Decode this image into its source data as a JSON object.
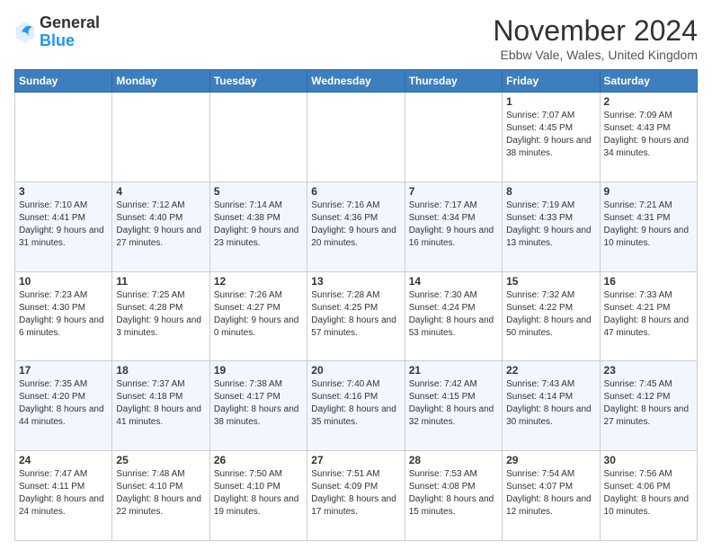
{
  "logo": {
    "general": "General",
    "blue": "Blue"
  },
  "header": {
    "month": "November 2024",
    "location": "Ebbw Vale, Wales, United Kingdom"
  },
  "days_of_week": [
    "Sunday",
    "Monday",
    "Tuesday",
    "Wednesday",
    "Thursday",
    "Friday",
    "Saturday"
  ],
  "weeks": [
    [
      {
        "day": "",
        "info": ""
      },
      {
        "day": "",
        "info": ""
      },
      {
        "day": "",
        "info": ""
      },
      {
        "day": "",
        "info": ""
      },
      {
        "day": "",
        "info": ""
      },
      {
        "day": "1",
        "info": "Sunrise: 7:07 AM\nSunset: 4:45 PM\nDaylight: 9 hours\nand 38 minutes."
      },
      {
        "day": "2",
        "info": "Sunrise: 7:09 AM\nSunset: 4:43 PM\nDaylight: 9 hours\nand 34 minutes."
      }
    ],
    [
      {
        "day": "3",
        "info": "Sunrise: 7:10 AM\nSunset: 4:41 PM\nDaylight: 9 hours\nand 31 minutes."
      },
      {
        "day": "4",
        "info": "Sunrise: 7:12 AM\nSunset: 4:40 PM\nDaylight: 9 hours\nand 27 minutes."
      },
      {
        "day": "5",
        "info": "Sunrise: 7:14 AM\nSunset: 4:38 PM\nDaylight: 9 hours\nand 23 minutes."
      },
      {
        "day": "6",
        "info": "Sunrise: 7:16 AM\nSunset: 4:36 PM\nDaylight: 9 hours\nand 20 minutes."
      },
      {
        "day": "7",
        "info": "Sunrise: 7:17 AM\nSunset: 4:34 PM\nDaylight: 9 hours\nand 16 minutes."
      },
      {
        "day": "8",
        "info": "Sunrise: 7:19 AM\nSunset: 4:33 PM\nDaylight: 9 hours\nand 13 minutes."
      },
      {
        "day": "9",
        "info": "Sunrise: 7:21 AM\nSunset: 4:31 PM\nDaylight: 9 hours\nand 10 minutes."
      }
    ],
    [
      {
        "day": "10",
        "info": "Sunrise: 7:23 AM\nSunset: 4:30 PM\nDaylight: 9 hours\nand 6 minutes."
      },
      {
        "day": "11",
        "info": "Sunrise: 7:25 AM\nSunset: 4:28 PM\nDaylight: 9 hours\nand 3 minutes."
      },
      {
        "day": "12",
        "info": "Sunrise: 7:26 AM\nSunset: 4:27 PM\nDaylight: 9 hours\nand 0 minutes."
      },
      {
        "day": "13",
        "info": "Sunrise: 7:28 AM\nSunset: 4:25 PM\nDaylight: 8 hours\nand 57 minutes."
      },
      {
        "day": "14",
        "info": "Sunrise: 7:30 AM\nSunset: 4:24 PM\nDaylight: 8 hours\nand 53 minutes."
      },
      {
        "day": "15",
        "info": "Sunrise: 7:32 AM\nSunset: 4:22 PM\nDaylight: 8 hours\nand 50 minutes."
      },
      {
        "day": "16",
        "info": "Sunrise: 7:33 AM\nSunset: 4:21 PM\nDaylight: 8 hours\nand 47 minutes."
      }
    ],
    [
      {
        "day": "17",
        "info": "Sunrise: 7:35 AM\nSunset: 4:20 PM\nDaylight: 8 hours\nand 44 minutes."
      },
      {
        "day": "18",
        "info": "Sunrise: 7:37 AM\nSunset: 4:18 PM\nDaylight: 8 hours\nand 41 minutes."
      },
      {
        "day": "19",
        "info": "Sunrise: 7:38 AM\nSunset: 4:17 PM\nDaylight: 8 hours\nand 38 minutes."
      },
      {
        "day": "20",
        "info": "Sunrise: 7:40 AM\nSunset: 4:16 PM\nDaylight: 8 hours\nand 35 minutes."
      },
      {
        "day": "21",
        "info": "Sunrise: 7:42 AM\nSunset: 4:15 PM\nDaylight: 8 hours\nand 32 minutes."
      },
      {
        "day": "22",
        "info": "Sunrise: 7:43 AM\nSunset: 4:14 PM\nDaylight: 8 hours\nand 30 minutes."
      },
      {
        "day": "23",
        "info": "Sunrise: 7:45 AM\nSunset: 4:12 PM\nDaylight: 8 hours\nand 27 minutes."
      }
    ],
    [
      {
        "day": "24",
        "info": "Sunrise: 7:47 AM\nSunset: 4:11 PM\nDaylight: 8 hours\nand 24 minutes."
      },
      {
        "day": "25",
        "info": "Sunrise: 7:48 AM\nSunset: 4:10 PM\nDaylight: 8 hours\nand 22 minutes."
      },
      {
        "day": "26",
        "info": "Sunrise: 7:50 AM\nSunset: 4:10 PM\nDaylight: 8 hours\nand 19 minutes."
      },
      {
        "day": "27",
        "info": "Sunrise: 7:51 AM\nSunset: 4:09 PM\nDaylight: 8 hours\nand 17 minutes."
      },
      {
        "day": "28",
        "info": "Sunrise: 7:53 AM\nSunset: 4:08 PM\nDaylight: 8 hours\nand 15 minutes."
      },
      {
        "day": "29",
        "info": "Sunrise: 7:54 AM\nSunset: 4:07 PM\nDaylight: 8 hours\nand 12 minutes."
      },
      {
        "day": "30",
        "info": "Sunrise: 7:56 AM\nSunset: 4:06 PM\nDaylight: 8 hours\nand 10 minutes."
      }
    ]
  ]
}
